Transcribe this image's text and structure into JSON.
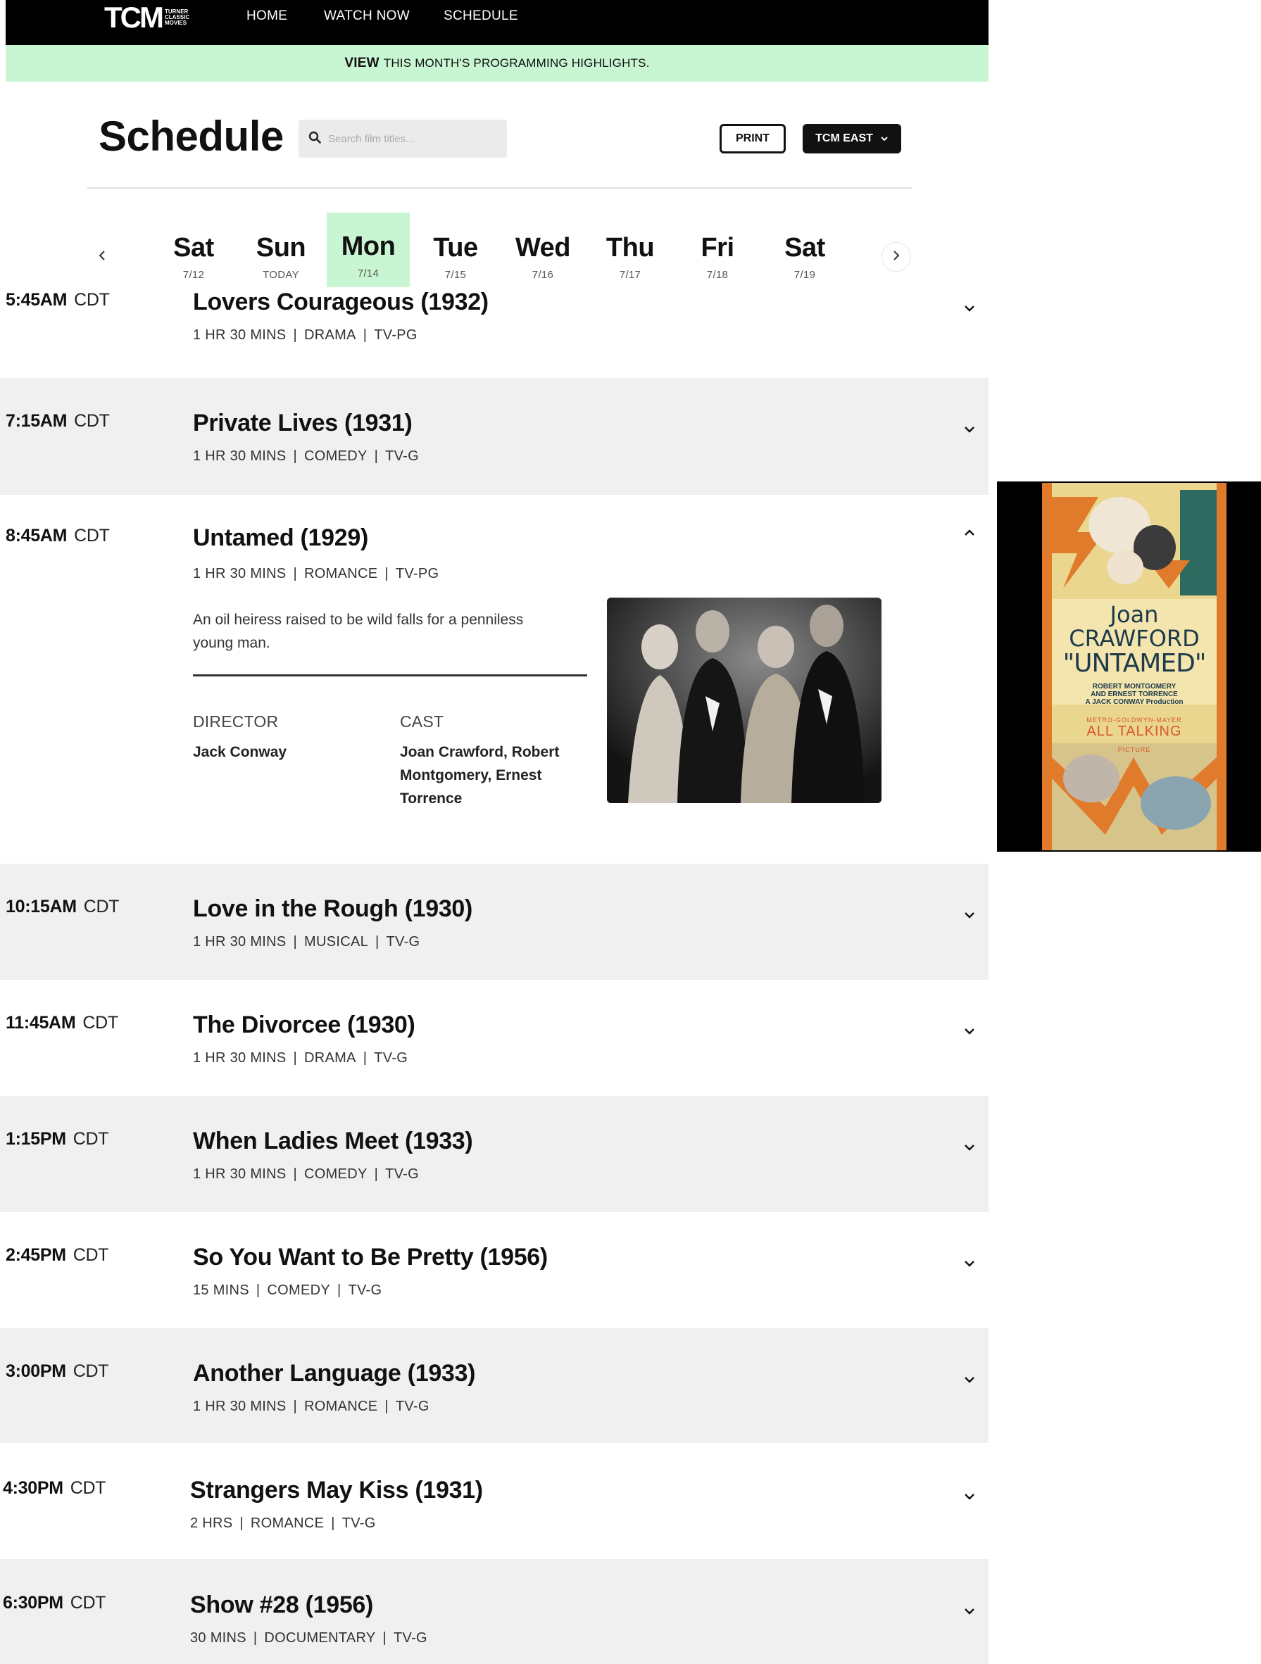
{
  "nav": {
    "logo": "TCM",
    "logo_sub": [
      "TURNER",
      "CLASSIC",
      "MOVIES"
    ],
    "links": [
      "HOME",
      "WATCH NOW",
      "SCHEDULE"
    ]
  },
  "promo": {
    "strong": "VIEW",
    "text": "THIS MONTH'S PROGRAMMING HIGHLIGHTS."
  },
  "header": {
    "title": "Schedule",
    "search_placeholder": "Search film titles...",
    "print_label": "PRINT",
    "feed_label": "TCM EAST"
  },
  "days": [
    {
      "name": "Sat",
      "date": "7/12"
    },
    {
      "name": "Sun",
      "date": "TODAY"
    },
    {
      "name": "Mon",
      "date": "7/14",
      "active": true
    },
    {
      "name": "Tue",
      "date": "7/15"
    },
    {
      "name": "Wed",
      "date": "7/16"
    },
    {
      "name": "Thu",
      "date": "7/17"
    },
    {
      "name": "Fri",
      "date": "7/18"
    },
    {
      "name": "Sat",
      "date": "7/19"
    }
  ],
  "schedule": [
    {
      "time": "5:45AM",
      "tz": "CDT",
      "title": "Lovers Courageous (1932)",
      "runtime": "1 HR 30 MINS",
      "genre": "DRAMA",
      "rating": "TV-PG"
    },
    {
      "time": "7:15AM",
      "tz": "CDT",
      "title": "Private Lives (1931)",
      "runtime": "1 HR 30 MINS",
      "genre": "COMEDY",
      "rating": "TV-G"
    },
    {
      "time": "8:45AM",
      "tz": "CDT",
      "title": "Untamed (1929)",
      "runtime": "1 HR 30 MINS",
      "genre": "ROMANCE",
      "rating": "TV-PG",
      "expanded": true
    },
    {
      "time": "10:15AM",
      "tz": "CDT",
      "title": "Love in the Rough (1930)",
      "runtime": "1 HR 30 MINS",
      "genre": "MUSICAL",
      "rating": "TV-G"
    },
    {
      "time": "11:45AM",
      "tz": "CDT",
      "title": "The Divorcee (1930)",
      "runtime": "1 HR 30 MINS",
      "genre": "DRAMA",
      "rating": "TV-G"
    },
    {
      "time": "1:15PM",
      "tz": "CDT",
      "title": "When Ladies Meet (1933)",
      "runtime": "1 HR 30 MINS",
      "genre": "COMEDY",
      "rating": "TV-G"
    },
    {
      "time": "2:45PM",
      "tz": "CDT",
      "title": "So You Want to Be Pretty (1956)",
      "runtime": "15 MINS",
      "genre": "COMEDY",
      "rating": "TV-G"
    },
    {
      "time": "3:00PM",
      "tz": "CDT",
      "title": "Another Language (1933)",
      "runtime": "1 HR 30 MINS",
      "genre": "ROMANCE",
      "rating": "TV-G"
    },
    {
      "time": "4:30PM",
      "tz": "CDT",
      "title": "Strangers May Kiss (1931)",
      "runtime": "2 HRS",
      "genre": "ROMANCE",
      "rating": "TV-G"
    },
    {
      "time": "6:30PM",
      "tz": "CDT",
      "title": "Show #28 (1956)",
      "runtime": "30 MINS",
      "genre": "DOCUMENTARY",
      "rating": "TV-G"
    }
  ],
  "detail": {
    "synopsis": "An oil heiress raised to be wild falls for a penniless young man.",
    "director_label": "DIRECTOR",
    "director": "Jack Conway",
    "cast_label": "CAST",
    "cast": "Joan Crawford, Robert Montgomery, Ernest Torrence"
  },
  "poster": {
    "star": [
      "Joan",
      "CRAWFORD"
    ],
    "title": "\"UNTAMED\"",
    "credits": [
      "ROBERT MONTGOMERY",
      "AND ERNEST TORRENCE",
      "A JACK CONWAY Production"
    ],
    "studio": "METRO-GOLDWYN-MAYER",
    "tagline": "ALL TALKING",
    "tagline_sub": "PICTURE"
  },
  "colors": {
    "accent_green": "#c8f5d2",
    "nav_bg": "#000000",
    "row_alt": "#f0f0f0"
  },
  "icons": [
    "search-icon",
    "chevron-down-icon",
    "chevron-up-icon",
    "chevron-left-icon",
    "chevron-right-icon"
  ]
}
